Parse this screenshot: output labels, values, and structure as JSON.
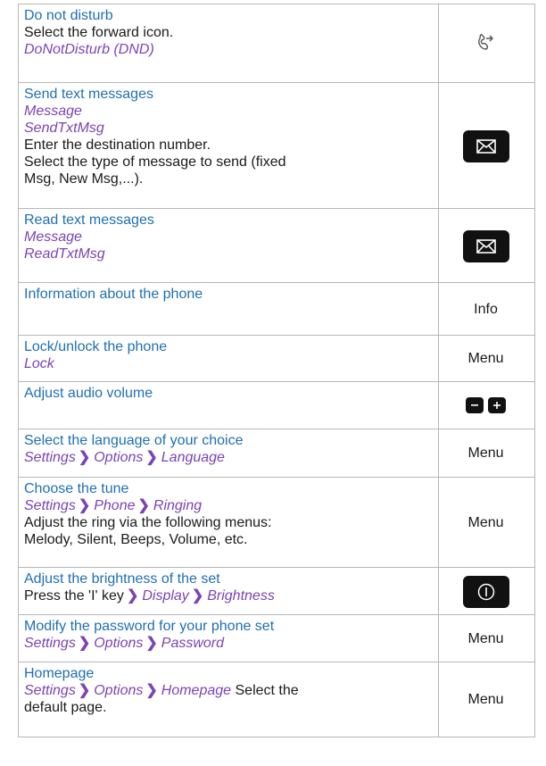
{
  "rows": [
    {
      "title": "Do not disturb",
      "line1": "Select the forward icon.",
      "path1": "DoNotDisturb (DND)"
    },
    {
      "title": "Send text messages",
      "path1": "Message",
      "path2": "SendTxtMsg",
      "line1": "Enter the destination number.",
      "line2": "Select the type of message to send (fixed",
      "line3": "Msg, New Msg,...)."
    },
    {
      "title": "Read text messages",
      "path1": "Message",
      "path2": "ReadTxtMsg"
    },
    {
      "title": "Information about the phone",
      "action": "Info"
    },
    {
      "title": "Lock/unlock the phone",
      "path1": "Lock",
      "action": "Menu"
    },
    {
      "title": "Adjust audio volume"
    },
    {
      "title": "Select the language of your choice",
      "crumbs": [
        "Settings",
        "Options",
        "Language"
      ],
      "action": "Menu"
    },
    {
      "title": "Choose the tune",
      "crumbs": [
        "Settings",
        "Phone",
        "Ringing"
      ],
      "line1": "Adjust the ring via the following menus:",
      "line2": "Melody, Silent, Beeps, Volume, etc.",
      "action": "Menu"
    },
    {
      "title": "Adjust the brightness of the set",
      "prefix": "Press the 'I' key",
      "crumbs": [
        "Display",
        "Brightness"
      ]
    },
    {
      "title": "Modify the password for your phone set",
      "crumbs": [
        "Settings",
        "Options",
        "Password"
      ],
      "action": "Menu"
    },
    {
      "title": "Homepage",
      "crumbs": [
        "Settings",
        "Options",
        "Homepage"
      ],
      "suffix": "Select the",
      "line2": "default page.",
      "action": "Menu"
    }
  ],
  "separator": "❯",
  "icons": {
    "forward": "forward-icon",
    "message": "envelope-icon",
    "minus": "minus-icon",
    "plus": "plus-icon",
    "info": "info-icon"
  }
}
